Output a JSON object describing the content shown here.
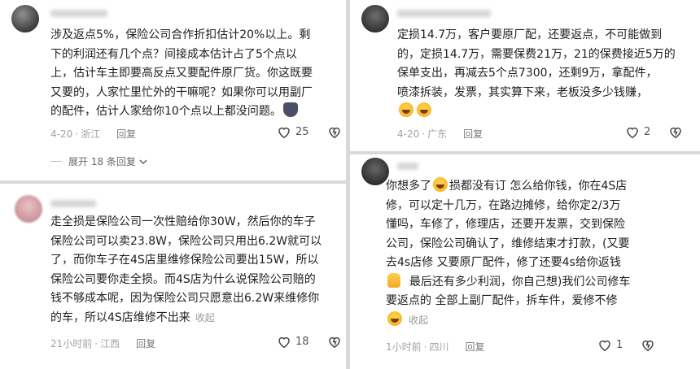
{
  "comments": [
    {
      "lines": [
        "涉及返点5%，保险公司合作折扣估计20%以上。剩",
        "下的利润还有几个点？间接成本估计占了5个点以",
        "上，估计车主即要高反点又要配件原厂货。你这既要",
        "又要的，人家忙里忙外的干嘛呢？如果你可以用副厂",
        "的配件，估计人家给你10个点以上都没问题。"
      ],
      "time": "4-20",
      "location": "浙江",
      "reply_label": "回复",
      "likes": "25",
      "expand_label": "展开 18 条回复"
    },
    {
      "lines": [
        "走全损是保险公司一次性赔给你30W，然后你的车子",
        "保险公司可以卖23.8W，保险公司只用出6.2W就可以",
        "了，而你车子在4S店里维修保险公司要出15W，所以",
        "保险公司要你走全损。而4S店为什么说保险公司赔的",
        "钱不够成本呢，因为保险公司只愿意出6.2W来维修你",
        "的车，所以4S店维修不出来"
      ],
      "collapse_label": "收起",
      "time": "21小时前",
      "location": "江西",
      "reply_label": "回复",
      "likes": "18"
    },
    {
      "lines": [
        "定损14.7万，客户要原厂配，还要返点，不可能做到",
        "的，定损14.7万，需要保费21万，21的保费接近5万的",
        "保单支出，再减去5个点7300，还剩9万，拿配件，",
        "喷漆拆装，发票，其实算下来，老板没多少钱赚，"
      ],
      "time": "4-20",
      "location": "广东",
      "reply_label": "回复",
      "likes": "2"
    },
    {
      "lines": [
        "你想多了",
        "损都没有订   怎么给你钱，你在4S店",
        "修，可以定十几万，在路边摊修，给你定2/3万",
        "懂吗，车修了，修理店，还要开发票，交到保险",
        "公司，保险公司确认了，维修结束才打款，(又要",
        "去4s店修 又要原厂配件，修了还要4s给你返钱",
        "最后还有多少利润，你自己想)我们公司修车",
        "要返点的 全部上副厂配件，拆车件，爱修不修"
      ],
      "collapse_label": "收起",
      "time": "1小时前",
      "location": "四川",
      "reply_label": "回复",
      "likes": "1"
    }
  ],
  "icons": [
    "heart-icon",
    "dislike-icon",
    "chevron-down-icon",
    "laugh-emoji",
    "cat-emoji",
    "thumbs-up-emoji"
  ]
}
